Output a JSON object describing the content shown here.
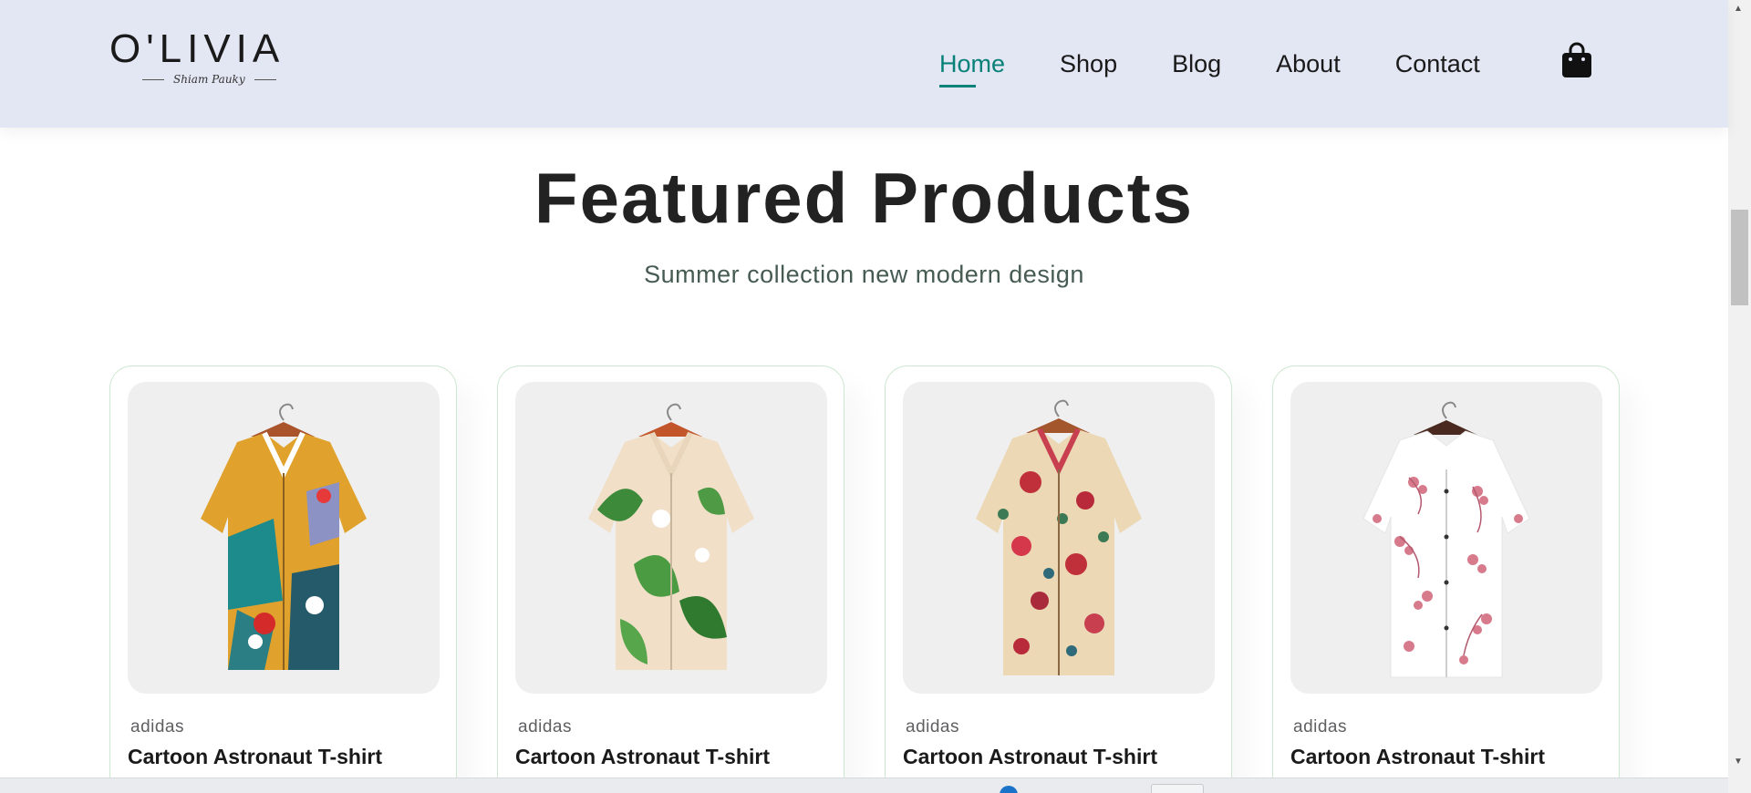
{
  "header": {
    "logo": {
      "name": "O'LIVIA",
      "tagline": "Shiam Pauky"
    },
    "nav": [
      {
        "label": "Home",
        "active": true
      },
      {
        "label": "Shop",
        "active": false
      },
      {
        "label": "Blog",
        "active": false
      },
      {
        "label": "About",
        "active": false
      },
      {
        "label": "Contact",
        "active": false
      }
    ],
    "cart_icon": "shopping-bag-icon"
  },
  "featured": {
    "title": "Featured Products",
    "subtitle": "Summer collection new modern design",
    "products": [
      {
        "brand": "adidas",
        "name": "Cartoon Astronaut T-shirt",
        "image": "multicolor-abstract-print-shirt"
      },
      {
        "brand": "adidas",
        "name": "Cartoon Astronaut T-shirt",
        "image": "cream-green-leaf-print-shirt"
      },
      {
        "brand": "adidas",
        "name": "Cartoon Astronaut T-shirt",
        "image": "cream-red-floral-print-shirt"
      },
      {
        "brand": "adidas",
        "name": "Cartoon Astronaut T-shirt",
        "image": "white-pink-blossom-print-shirt"
      }
    ]
  },
  "colors": {
    "accent": "#088178",
    "header_bg": "#e3e6f3",
    "card_border": "#cce7d0"
  }
}
